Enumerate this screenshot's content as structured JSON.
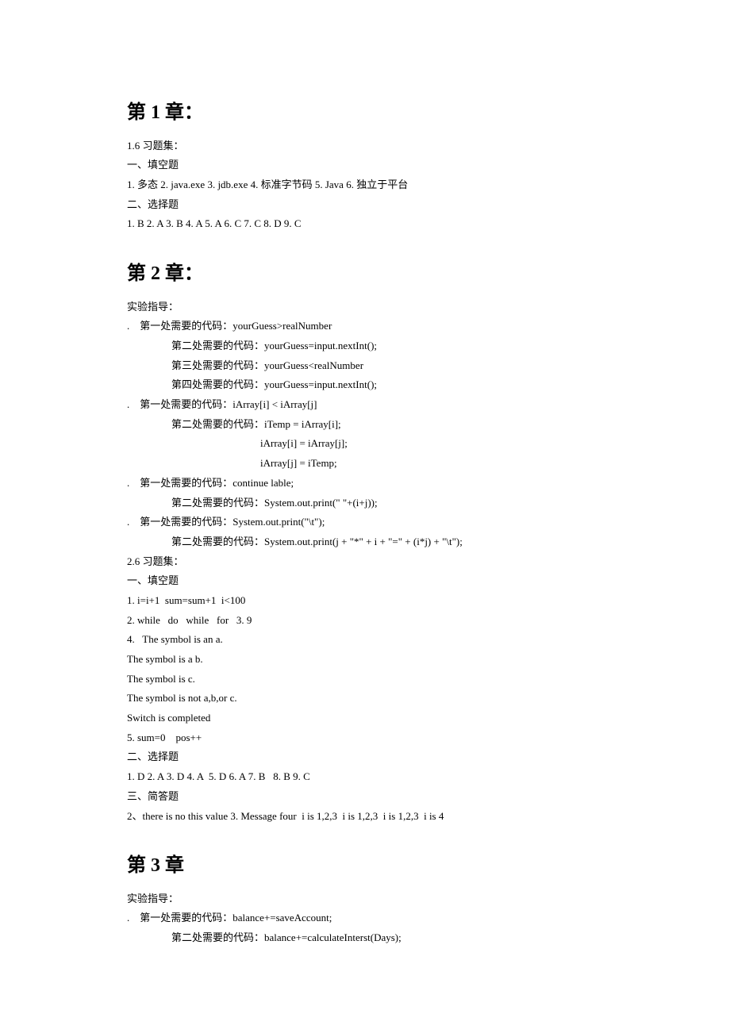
{
  "chapter1": {
    "heading": "第 1 章：",
    "lines": [
      "1.6 习题集：",
      "一、填空题",
      "1. 多态 2. java.exe 3. jdb.exe 4. 标准字节码 5. Java 6. 独立于平台",
      "二、选择题",
      "1. B 2. A 3. B 4. A 5. A 6. C 7. C 8. D 9. C"
    ]
  },
  "chapter2": {
    "heading": "第 2 章：",
    "intro": "实验指导：",
    "blocks": [
      {
        "first": ".    第一处需要的代码：yourGuess>realNumber",
        "rest": [
          "第二处需要的代码：yourGuess=input.nextInt();",
          "第三处需要的代码：yourGuess<realNumber",
          "第四处需要的代码：yourGuess=input.nextInt();"
        ]
      },
      {
        "first": ".    第一处需要的代码：iArray[i] < iArray[j]",
        "rest": [
          "第二处需要的代码：iTemp = iArray[i];"
        ],
        "deep": [
          "iArray[i] = iArray[j];",
          "iArray[j] = iTemp;"
        ]
      },
      {
        "first": ".    第一处需要的代码：continue lable;",
        "rest": [
          "第二处需要的代码：System.out.print(\" \"+(i+j));"
        ]
      },
      {
        "first": ".    第一处需要的代码：System.out.print(\"\\t\");",
        "rest": [
          "第二处需要的代码：System.out.print(j + \"*\" + i + \"=\" + (i*j) + \"\\t\");"
        ]
      }
    ],
    "lines": [
      "2.6 习题集：",
      "一、填空题",
      "1. i=i+1  sum=sum+1  i<100",
      "2. while   do   while   for   3. 9",
      "4.   The symbol is an a.",
      "The symbol is a b.",
      "The symbol is c.",
      "The symbol is not a,b,or c.",
      "Switch is completed",
      "5. sum=0    pos++",
      "二、选择题",
      "1. D 2. A 3. D 4. A  5. D 6. A 7. B   8. B 9. C",
      "三、简答题",
      "2、there is no this value 3. Message four  i is 1,2,3  i is 1,2,3  i is 1,2,3  i is 4"
    ]
  },
  "chapter3": {
    "heading": "第 3 章",
    "intro": "实验指导：",
    "blocks": [
      {
        "first": ".    第一处需要的代码：balance+=saveAccount;",
        "rest": [
          "第二处需要的代码：balance+=calculateInterst(Days);"
        ]
      }
    ]
  }
}
